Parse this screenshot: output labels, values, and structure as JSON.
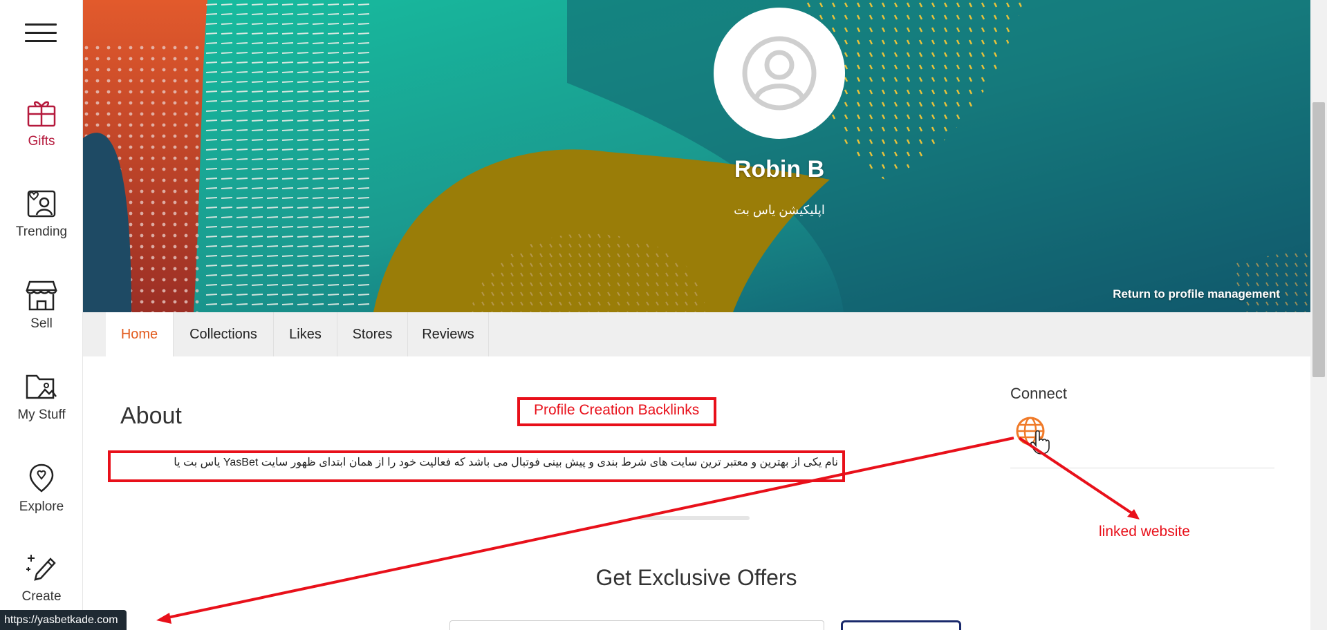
{
  "sidebar": {
    "items": [
      {
        "label": "Gifts",
        "icon": "gift-icon"
      },
      {
        "label": "Trending",
        "icon": "trending-heart-icon"
      },
      {
        "label": "Sell",
        "icon": "store-icon"
      },
      {
        "label": "My Stuff",
        "icon": "folder-image-icon"
      },
      {
        "label": "Explore",
        "icon": "explore-pin-icon"
      },
      {
        "label": "Create",
        "icon": "create-pen-icon"
      }
    ],
    "active_color": "#b5193c"
  },
  "profile": {
    "name": "Robin B",
    "subtitle": "اپلیکیشن یاس بت",
    "return_link": "Return to profile management"
  },
  "tabs": [
    {
      "label": "Home",
      "active": true
    },
    {
      "label": "Collections"
    },
    {
      "label": "Likes"
    },
    {
      "label": "Stores"
    },
    {
      "label": "Reviews"
    }
  ],
  "about": {
    "title": "About",
    "text": "نام یکی از بهترین و معتبر ترین سایت های شرط بندی و پیش بینی فوتبال می باشد که فعالیت خود را از همان ابتدای ظهور سایت YasBet یاس بت یا"
  },
  "connect": {
    "title": "Connect",
    "icon": "globe-icon"
  },
  "annotations": {
    "backlinks_label": "Profile Creation Backlinks",
    "linked_label": "linked website",
    "color": "#e8101a"
  },
  "offers": {
    "title": "Get Exclusive Offers"
  },
  "status_bar": {
    "url": "https://yasbetkade.com"
  },
  "colors": {
    "active_tab": "#e25a1c",
    "globe": "#f07a28"
  }
}
